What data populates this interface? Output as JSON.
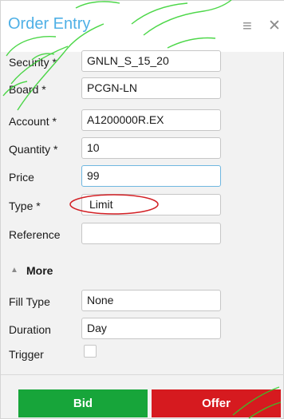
{
  "window": {
    "title": "Order Entry",
    "menu_icon": "hamburger-menu-icon",
    "close_icon": "close-icon"
  },
  "form": {
    "security": {
      "label": "Security *",
      "value": "GNLN_S_15_20"
    },
    "board": {
      "label": "Board *",
      "value": "PCGN-LN"
    },
    "account": {
      "label": "Account *",
      "value": "A1200000R.EX"
    },
    "quantity": {
      "label": "Quantity *",
      "value": "10"
    },
    "price": {
      "label": "Price",
      "value": "99"
    },
    "type": {
      "label": "Type *",
      "value": "Limit"
    },
    "reference": {
      "label": "Reference",
      "value": ""
    }
  },
  "more": {
    "label": "More",
    "expanded": true,
    "fill_type": {
      "label": "Fill Type",
      "value": "None"
    },
    "duration": {
      "label": "Duration",
      "value": "Day"
    },
    "trigger": {
      "label": "Trigger",
      "checked": false
    }
  },
  "actions": {
    "bid_label": "Bid",
    "offer_label": "Offer"
  },
  "colors": {
    "title": "#4fb0e6",
    "bid": "#17a53a",
    "offer": "#d61a1f",
    "annotation": "#d21f24",
    "watermark": "#2ed12a"
  }
}
